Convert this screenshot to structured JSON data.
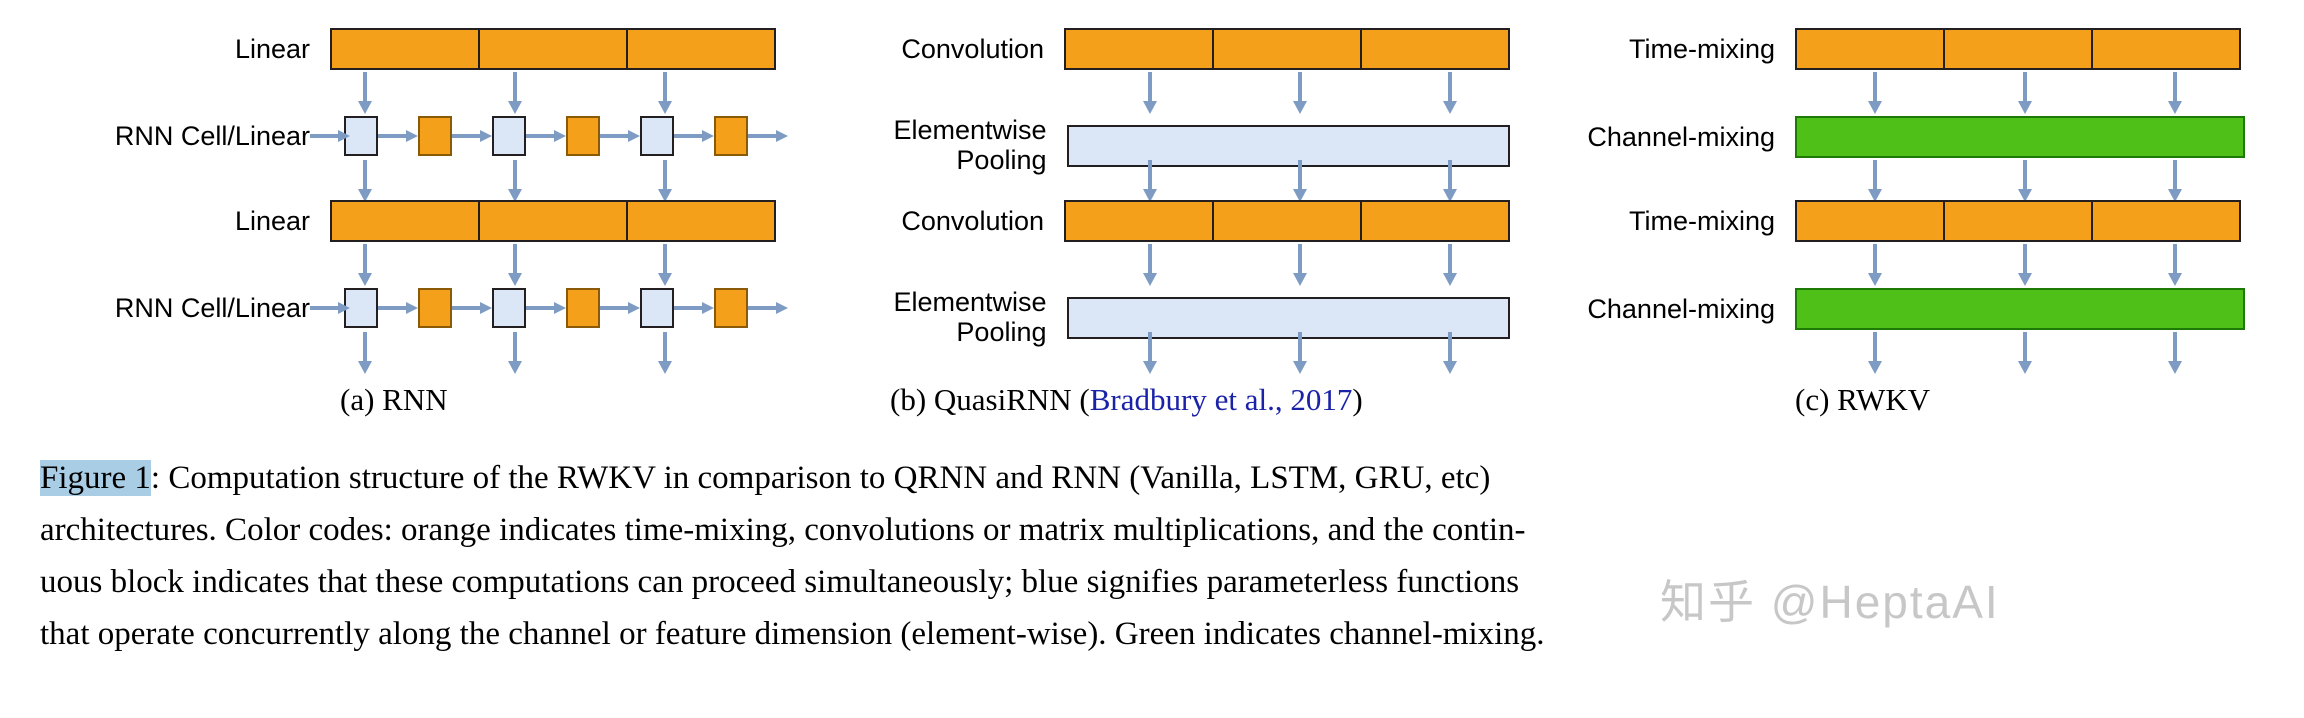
{
  "figure": {
    "label": "Figure 1",
    "label_highlight_color": "#a8cde4",
    "caption_lines": [
      ": Computation structure of the RWKV in comparison to QRNN and RNN (Vanilla, LSTM, GRU, etc)",
      "architectures. Color codes: orange indicates time-mixing, convolutions or matrix multiplications, and the contin-",
      "uous block indicates that these computations can proceed simultaneously; blue signifies parameterless functions",
      "that operate concurrently along the channel or feature dimension (element-wise). Green indicates channel-mixing."
    ]
  },
  "watermark": {
    "text": "知乎 @HeptaAI"
  },
  "colors": {
    "orange": "#f5a01b",
    "blue": "#dbe7f7",
    "green": "#4fc018",
    "arrow": "#7e9bc4",
    "outline": "#231f20",
    "citation_link": "#1a23a8"
  },
  "panels": [
    {
      "id": "a",
      "subcaption": "(a) RNN",
      "citation": "",
      "rows": [
        {
          "label": "Linear",
          "kind": "segmented",
          "segments": 3,
          "color": "orange"
        },
        {
          "label": "RNN Cell/Linear",
          "kind": "cells",
          "cells": [
            "blue",
            "orange",
            "blue",
            "orange",
            "blue",
            "orange"
          ]
        },
        {
          "label": "Linear",
          "kind": "segmented",
          "segments": 3,
          "color": "orange"
        },
        {
          "label": "RNN Cell/Linear",
          "kind": "cells",
          "cells": [
            "blue",
            "orange",
            "blue",
            "orange",
            "blue",
            "orange"
          ]
        }
      ]
    },
    {
      "id": "b",
      "subcaption": "(b) QuasiRNN ",
      "citation": "Bradbury et al., 2017",
      "subcaption_open": "(",
      "subcaption_close": ")",
      "rows": [
        {
          "label": "Convolution",
          "kind": "segmented",
          "segments": 3,
          "color": "orange"
        },
        {
          "label": "Elementwise\nPooling",
          "kind": "continuous",
          "color": "blue"
        },
        {
          "label": "Convolution",
          "kind": "segmented",
          "segments": 3,
          "color": "orange"
        },
        {
          "label": "Elementwise\nPooling",
          "kind": "continuous",
          "color": "blue"
        }
      ]
    },
    {
      "id": "c",
      "subcaption": "(c) RWKV",
      "citation": "",
      "rows": [
        {
          "label": "Time-mixing",
          "kind": "segmented",
          "segments": 3,
          "color": "orange"
        },
        {
          "label": "Channel-mixing",
          "kind": "continuous",
          "color": "green"
        },
        {
          "label": "Time-mixing",
          "kind": "segmented",
          "segments": 3,
          "color": "orange"
        },
        {
          "label": "Channel-mixing",
          "kind": "continuous",
          "color": "green"
        }
      ]
    }
  ]
}
